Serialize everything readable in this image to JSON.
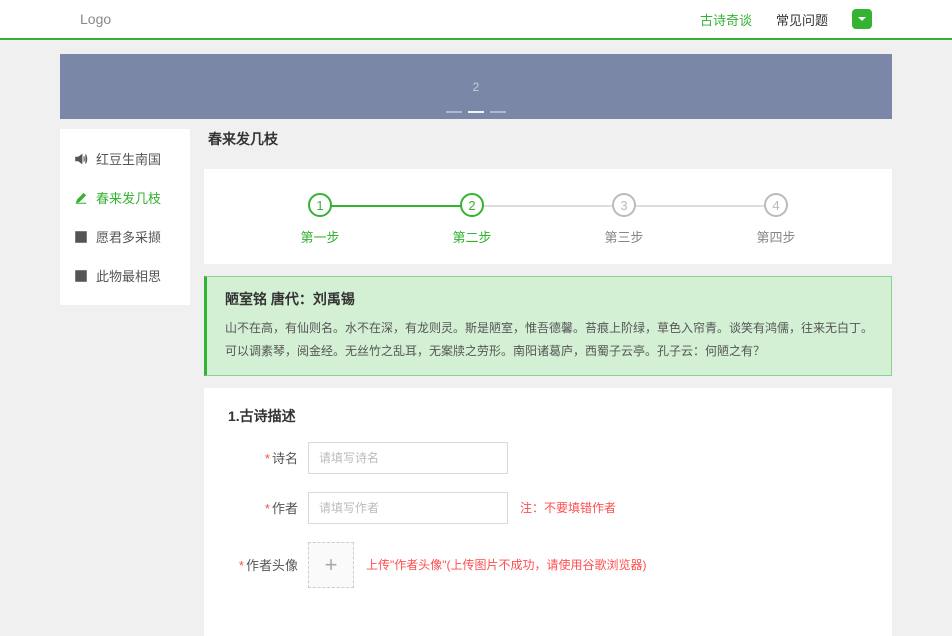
{
  "header": {
    "logo": "Logo",
    "nav": {
      "link1": "古诗奇谈",
      "link2": "常见问题"
    }
  },
  "banner": {
    "label": "2"
  },
  "sidebar": {
    "items": [
      {
        "label": "红豆生南国"
      },
      {
        "label": "春来发几枝"
      },
      {
        "label": "愿君多采撷"
      },
      {
        "label": "此物最相思"
      }
    ]
  },
  "main": {
    "title": "春来发几枝",
    "steps": [
      {
        "num": "1",
        "label": "第一步"
      },
      {
        "num": "2",
        "label": "第二步"
      },
      {
        "num": "3",
        "label": "第三步"
      },
      {
        "num": "4",
        "label": "第四步"
      }
    ],
    "poem": {
      "title": "陋室铭 唐代：刘禹锡",
      "body": "山不在高，有仙则名。水不在深，有龙则灵。斯是陋室，惟吾德馨。苔痕上阶绿，草色入帘青。谈笑有鸿儒，往来无白丁。可以调素琴，阅金经。无丝竹之乱耳，无案牍之劳形。南阳诸葛庐，西蜀子云亭。孔子云：何陋之有？"
    },
    "form": {
      "section": "1.古诗描述",
      "name_label": "诗名",
      "name_placeholder": "请填写诗名",
      "author_label": "作者",
      "author_placeholder": "请填写作者",
      "author_note": "注：不要填错作者",
      "avatar_label": "作者头像",
      "avatar_plus": "+",
      "avatar_note": "上传\"作者头像\"(上传图片不成功，请使用谷歌浏览器)"
    }
  }
}
